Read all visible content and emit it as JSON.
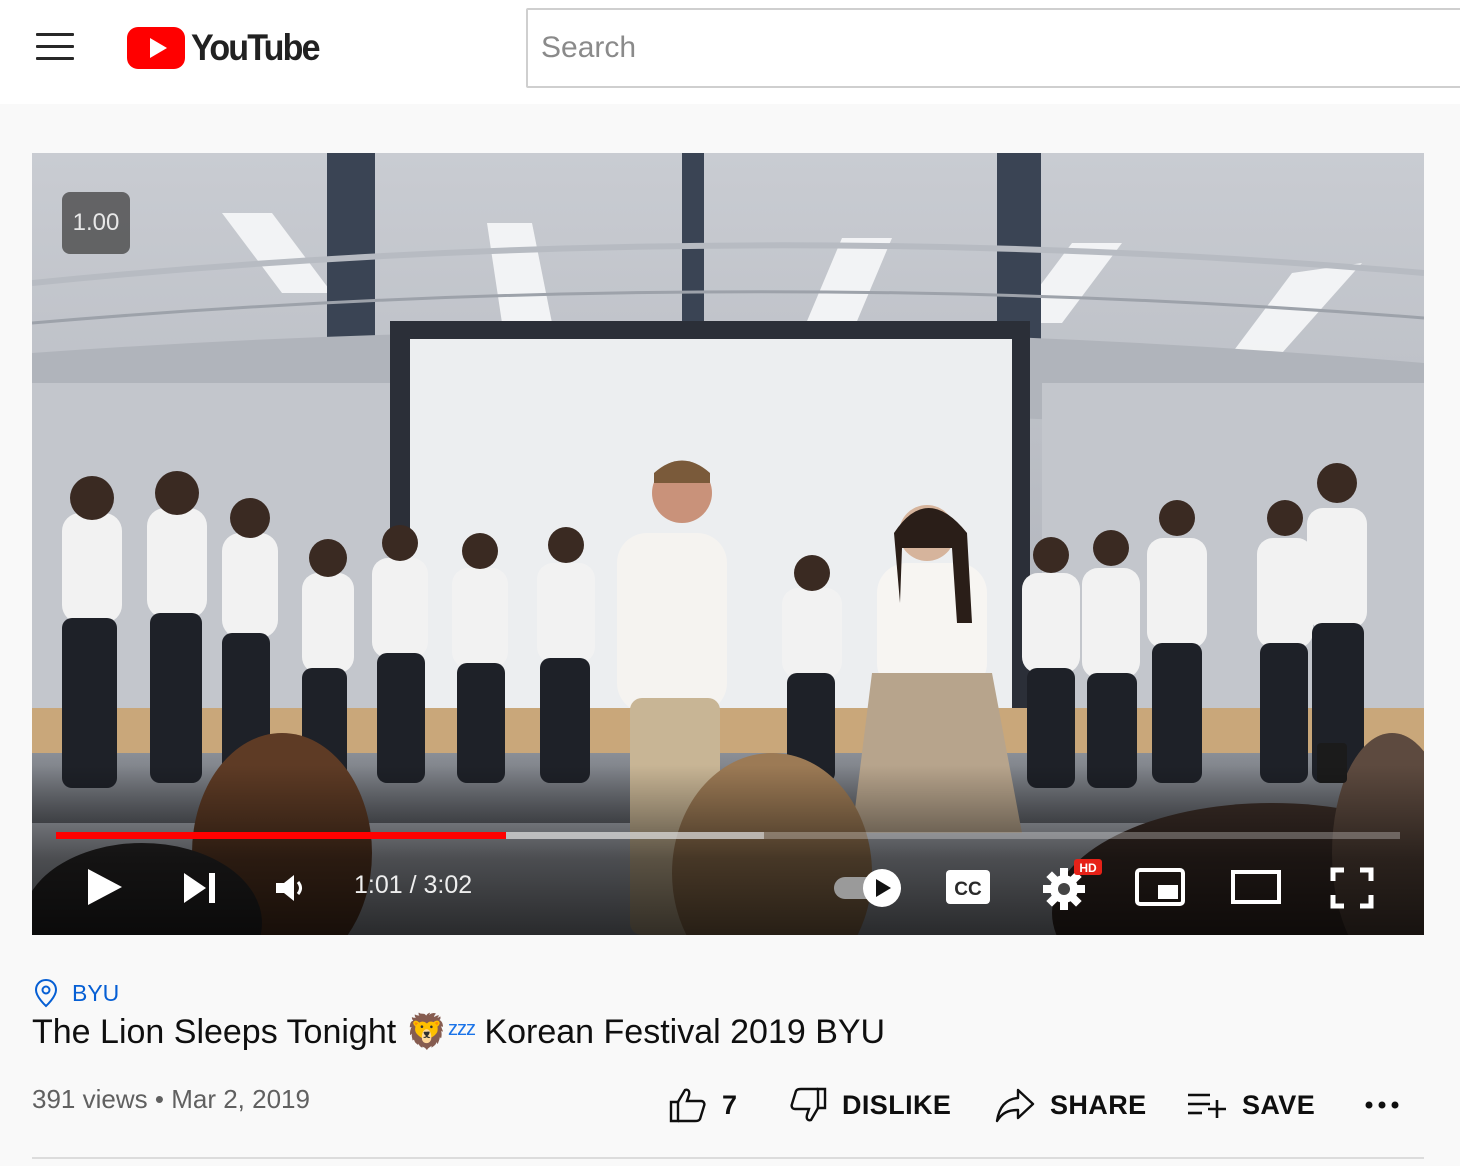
{
  "header": {
    "logo_text": "YouTube",
    "search_placeholder": "Search"
  },
  "player": {
    "speed_badge": "1.00",
    "current_time": "1:01",
    "duration": "3:02",
    "time_display": "1:01 / 3:02",
    "progress_played_fraction": 0.335,
    "progress_buffered_fraction": 0.527,
    "settings_badge": "HD",
    "autoplay_on": true
  },
  "video": {
    "location": "BYU",
    "title_part1": "The Lion Sleeps Tonight",
    "title_emoji": "🦁",
    "title_zzz": "zzz",
    "title_part2": "Korean Festival 2019 BYU",
    "views": "391 views",
    "date": "Mar 2, 2019",
    "meta_separator": "•"
  },
  "actions": {
    "like_count": "7",
    "dislike_label": "DISLIKE",
    "share_label": "SHARE",
    "save_label": "SAVE"
  },
  "colors": {
    "brand_red": "#ff0000",
    "link_blue": "#065fd4",
    "progress_red": "#ff0000"
  }
}
